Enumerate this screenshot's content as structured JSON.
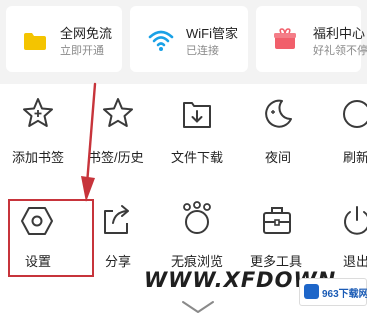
{
  "promo_cards": [
    {
      "title": "全网免流",
      "subtitle": "立即开通",
      "icon": "folder-icon",
      "color": "#f4c400"
    },
    {
      "title": "WiFi管家",
      "subtitle": "已连接",
      "icon": "wifi-icon",
      "color": "#1aa1e6"
    },
    {
      "title": "福利中心",
      "subtitle": "好礼领不停",
      "icon": "gift-icon",
      "color": "#f15f6b"
    }
  ],
  "menu_row1": [
    {
      "label": "添加书签",
      "icon": "star-plus-icon"
    },
    {
      "label": "书签/历史",
      "icon": "star-icon"
    },
    {
      "label": "文件下载",
      "icon": "download-icon"
    },
    {
      "label": "夜间",
      "icon": "moon-icon"
    },
    {
      "label": "刷新",
      "icon": "refresh-icon"
    }
  ],
  "menu_row2": [
    {
      "label": "设置",
      "icon": "hexagon-settings-icon"
    },
    {
      "label": "分享",
      "icon": "share-icon"
    },
    {
      "label": "无痕浏览",
      "icon": "incognito-icon"
    },
    {
      "label": "更多工具",
      "icon": "toolbox-icon"
    },
    {
      "label": "退出",
      "icon": "power-icon"
    }
  ],
  "watermark": {
    "text": "WWW.XFDOWN",
    "badge_text": "963下载网"
  },
  "colors": {
    "highlight": "#c7343b",
    "annotation_arrow": "#c7343b"
  }
}
